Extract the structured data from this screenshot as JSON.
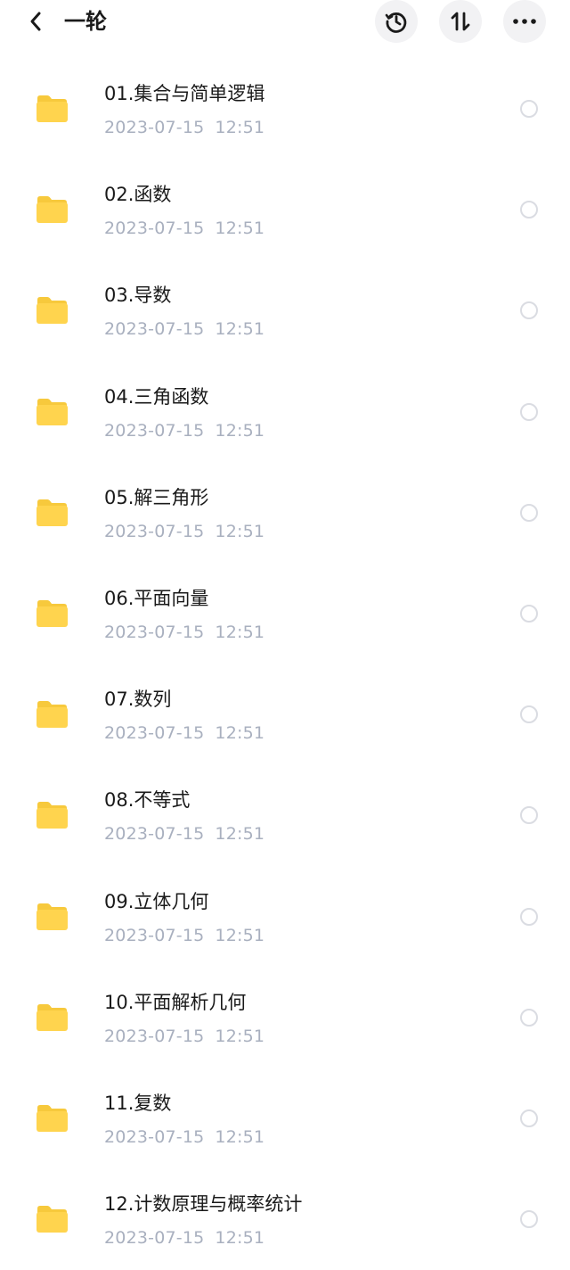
{
  "header": {
    "title": "一轮",
    "back_icon": "chevron-left-icon",
    "history_icon": "history-icon",
    "sort_icon": "sort-icon",
    "more_icon": "more-icon"
  },
  "colors": {
    "folder": "#ffd44e",
    "folder_tab": "#f7c93c",
    "meta_text": "#a9b0bf",
    "button_bg": "#f2f2f4"
  },
  "items": [
    {
      "name": "01.集合与简单逻辑",
      "date": "2023-07-15",
      "time": "12:51"
    },
    {
      "name": "02.函数",
      "date": "2023-07-15",
      "time": "12:51"
    },
    {
      "name": "03.导数",
      "date": "2023-07-15",
      "time": "12:51"
    },
    {
      "name": "04.三角函数",
      "date": "2023-07-15",
      "time": "12:51"
    },
    {
      "name": "05.解三角形",
      "date": "2023-07-15",
      "time": "12:51"
    },
    {
      "name": "06.平面向量",
      "date": "2023-07-15",
      "time": "12:51"
    },
    {
      "name": "07.数列",
      "date": "2023-07-15",
      "time": "12:51"
    },
    {
      "name": "08.不等式",
      "date": "2023-07-15",
      "time": "12:51"
    },
    {
      "name": "09.立体几何",
      "date": "2023-07-15",
      "time": "12:51"
    },
    {
      "name": "10.平面解析几何",
      "date": "2023-07-15",
      "time": "12:51"
    },
    {
      "name": "11.复数",
      "date": "2023-07-15",
      "time": "12:51"
    },
    {
      "name": "12.计数原理与概率统计",
      "date": "2023-07-15",
      "time": "12:51"
    }
  ]
}
